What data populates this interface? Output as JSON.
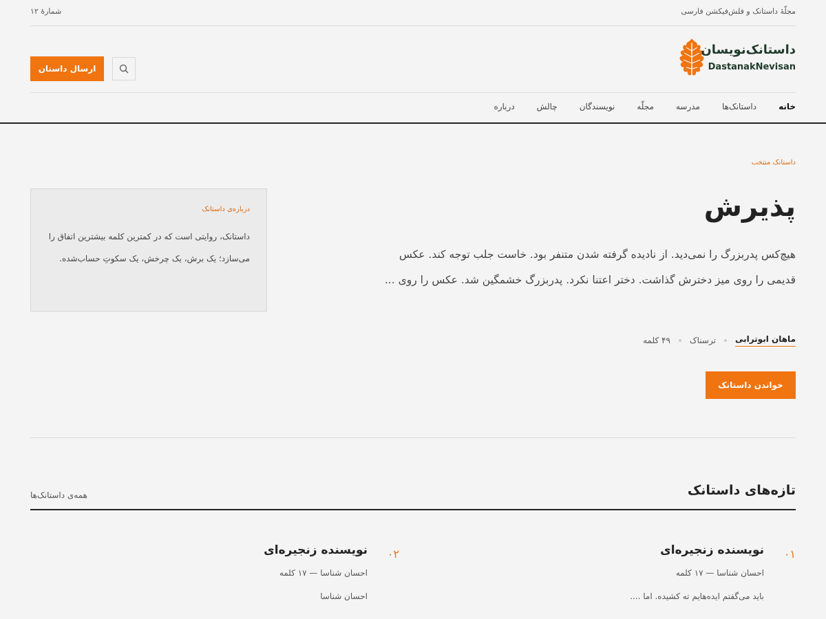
{
  "topbar": {
    "tagline": "مجلّهٔ داستانک و فلش‌فیکشن فارسی",
    "issue": "شمارهٔ ۱۲"
  },
  "brand": {
    "name_fa": "داستانک‌نویسان",
    "name_en": "DastanakNevisan",
    "leaf_color": "#f07410",
    "text_color": "#1f3b2b"
  },
  "header": {
    "submit_label": "ارسال داستان",
    "search_icon": "search-icon"
  },
  "nav": {
    "items": [
      "خانه",
      "داستانک‌ها",
      "مدرسه",
      "مجلّه",
      "نویسندگان",
      "چالش",
      "درباره"
    ]
  },
  "featured": {
    "label": "داستانک منتخب",
    "title": "پذیرش",
    "excerpt": "هیچ‌کس پدربزرگ را نمی‌دید. از نادیده گرفته شدن متنفر بود. خاست جلب توجه کند. عکس قدیمی را روی میز دخترش گذاشت. دختر اعتنا نکرد. پدربزرگ خشمگین شد. عکس را روی ...",
    "author": "ماهان ابوترابی",
    "genre": "ترسناک",
    "words": "۴۹ کلمه",
    "read_label": "خواندن داستانک"
  },
  "about": {
    "label": "درباره‌ی داستانک",
    "text": "داستانک، روایتی است که در کمترین کلمه بیشترین اتفاق را می‌سازد؛ یک برش، یک چرخش، یک سکوتِ حساب‌شده."
  },
  "latest": {
    "title": "تازه‌های داستانک",
    "all_link": "همه‌ی داستانک‌ها",
    "cards": [
      {
        "num": "۰۱",
        "title": "نویسنده زنجیره‌ای",
        "meta": "احسان شناسا — ۱۷ کلمه",
        "excerpt": "باید می‌گفتم ایده‌هایم ته کشیده. اما ...."
      },
      {
        "num": "۰۲",
        "title": "نویسنده زنجیره‌ای",
        "meta": "احسان شناسا — ۱۷ کلمه",
        "excerpt": "احسان شناسا"
      }
    ]
  },
  "colors": {
    "accent": "#f07410",
    "background": "#f4f4f4"
  }
}
